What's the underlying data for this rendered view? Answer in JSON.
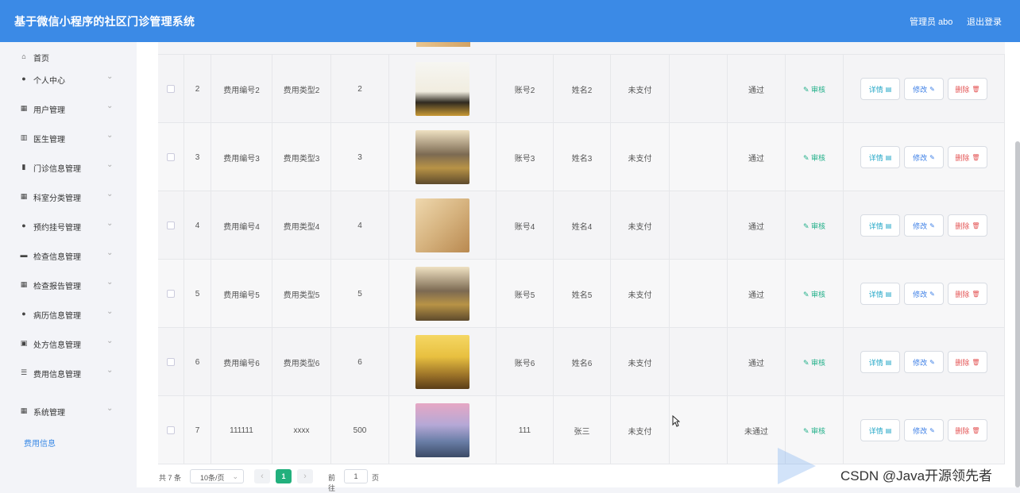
{
  "header": {
    "title": "基于微信小程序的社区门诊管理系统",
    "user": "管理员 abo",
    "logout": "退出登录"
  },
  "sidebar": {
    "items": [
      {
        "label": "首页",
        "icon": "home-icon",
        "glyph": "⌂",
        "has_caret": false
      },
      {
        "label": "个人中心",
        "icon": "person-icon",
        "glyph": "●",
        "has_caret": true
      },
      {
        "label": "用户管理",
        "icon": "grid-icon",
        "glyph": "▦",
        "has_caret": true
      },
      {
        "label": "医生管理",
        "icon": "bar-chart-icon",
        "glyph": "▥",
        "has_caret": true
      },
      {
        "label": "门诊信息管理",
        "icon": "bar-chart-icon",
        "glyph": "▮",
        "has_caret": true
      },
      {
        "label": "科室分类管理",
        "icon": "grid-icon",
        "glyph": "▦",
        "has_caret": true
      },
      {
        "label": "预约挂号管理",
        "icon": "location-icon",
        "glyph": "●",
        "has_caret": true
      },
      {
        "label": "检查信息管理",
        "icon": "card-icon",
        "glyph": "▬",
        "has_caret": true
      },
      {
        "label": "检查报告管理",
        "icon": "grid-icon",
        "glyph": "▦",
        "has_caret": true
      },
      {
        "label": "病历信息管理",
        "icon": "person-icon",
        "glyph": "●",
        "has_caret": true
      },
      {
        "label": "处方信息管理",
        "icon": "checkbox-icon",
        "glyph": "▣",
        "has_caret": true
      },
      {
        "label": "费用信息管理",
        "icon": "list-icon",
        "glyph": "☰",
        "has_caret": true
      },
      {
        "label": "系统管理",
        "icon": "grid-icon",
        "glyph": "▦",
        "has_caret": true
      }
    ],
    "active_sub": "费用信息"
  },
  "table": {
    "audit_label": "审核",
    "detail_label": "详情",
    "edit_label": "修改",
    "delete_label": "删除",
    "rows": [
      {
        "index": "2",
        "code": "费用编号2",
        "type": "费用类型2",
        "amount": "2",
        "image": "thumb-lightbulbs",
        "account": "账号2",
        "name": "姓名2",
        "pay_status": "未支付",
        "audit_status": "通过"
      },
      {
        "index": "3",
        "code": "费用编号3",
        "type": "费用类型3",
        "amount": "3",
        "image": "thumb-coins",
        "account": "账号3",
        "name": "姓名3",
        "pay_status": "未支付",
        "audit_status": "通过"
      },
      {
        "index": "4",
        "code": "费用编号4",
        "type": "费用类型4",
        "amount": "4",
        "image": "thumb-finance",
        "account": "账号4",
        "name": "姓名4",
        "pay_status": "未支付",
        "audit_status": "通过"
      },
      {
        "index": "5",
        "code": "费用编号5",
        "type": "费用类型5",
        "amount": "5",
        "image": "thumb-coins",
        "account": "账号5",
        "name": "姓名5",
        "pay_status": "未支付",
        "audit_status": "通过"
      },
      {
        "index": "6",
        "code": "费用编号6",
        "type": "费用类型6",
        "amount": "6",
        "image": "thumb-gold",
        "account": "账号6",
        "name": "姓名6",
        "pay_status": "未支付",
        "audit_status": "通过"
      },
      {
        "index": "7",
        "code": "111111",
        "type": "xxxx",
        "amount": "500",
        "image": "thumb-bridge",
        "account": "111",
        "name": "张三",
        "pay_status": "未支付",
        "audit_status": "未通过"
      }
    ]
  },
  "pagination": {
    "total": "共 7 条",
    "page_size": "10条/页",
    "current": "1",
    "goto_prefix": "前往",
    "goto_value": "1",
    "goto_suffix": "页"
  },
  "watermark": "CSDN @Java开源领先者"
}
